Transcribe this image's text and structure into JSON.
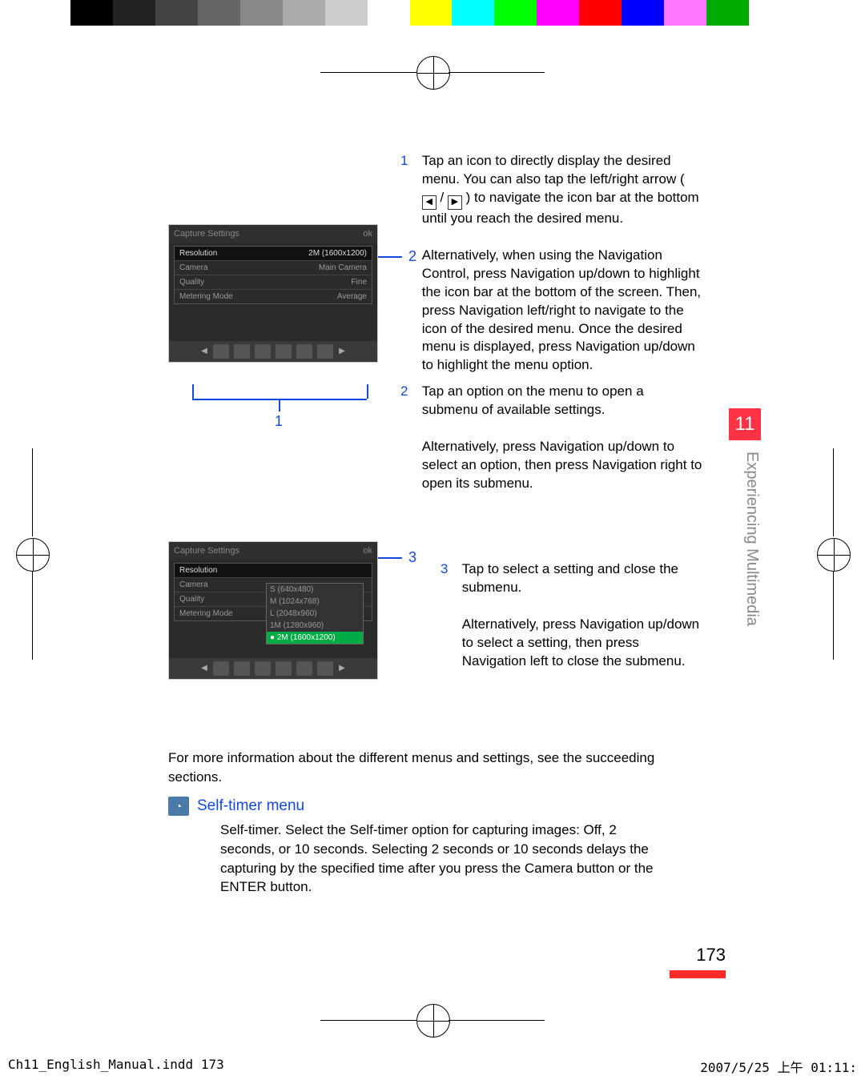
{
  "colorbar": [
    "#000",
    "#222",
    "#444",
    "#666",
    "#888",
    "#aaa",
    "#ccc",
    "#fff",
    "#ff0",
    "#0ff",
    "#0f0",
    "#f0f",
    "#f00",
    "#00f",
    "#f7f",
    "#0a0",
    "#fff"
  ],
  "chapter": {
    "number": "11",
    "title": "Experiencing Multimedia"
  },
  "page_number": "173",
  "callouts": {
    "c1": "1",
    "c2": "2",
    "c3": "3"
  },
  "screenshot1": {
    "title": "Capture Settings",
    "ok": "ok",
    "rows": [
      {
        "label": "Resolution",
        "value": "2M (1600x1200)",
        "sel": true
      },
      {
        "label": "Camera",
        "value": "Main Camera",
        "sel": false
      },
      {
        "label": "Quality",
        "value": "Fine",
        "sel": false
      },
      {
        "label": "Metering Mode",
        "value": "Average",
        "sel": false
      }
    ]
  },
  "screenshot2": {
    "title": "Capture Settings",
    "ok": "ok",
    "rows": [
      {
        "label": "Resolution",
        "value": "",
        "sel": true
      },
      {
        "label": "Camera",
        "value": "",
        "sel": false
      },
      {
        "label": "Quality",
        "value": "",
        "sel": false
      },
      {
        "label": "Metering Mode",
        "value": "",
        "sel": false
      }
    ],
    "dropdown": [
      {
        "t": "S (640x480)",
        "sel": false
      },
      {
        "t": "M (1024x768)",
        "sel": false
      },
      {
        "t": "L (2048x960)",
        "sel": false
      },
      {
        "t": "1M (1280x960)",
        "sel": false
      },
      {
        "t": "2M (1600x1200)",
        "sel": true
      }
    ]
  },
  "steps": {
    "s1a": "Tap an icon to directly display the desired menu. You can also tap the left/right arrow (",
    "s1b": ") to navigate the icon bar at the bottom until you reach the desired menu.",
    "s1c": "Alternatively, when using the Navigation Control, press Navigation up/down to highlight the icon bar at the bottom of the screen. Then, press Navigation left/right to navigate to the icon of the desired menu. Once the desired menu is displayed, press Navigation up/down to highlight the menu option.",
    "s2a": "Tap an option on the menu to open a submenu of available settings.",
    "s2b": "Alternatively, press Navigation up/down to select an option, then press Navigation right to open its submenu.",
    "s3a": "Tap to select a setting and close the submenu.",
    "s3b": "Alternatively, press Navigation up/down to select a setting, then press Navigation left to close the submenu."
  },
  "body": "For more information about the different menus and settings, see the succeeding sections.",
  "section": {
    "title": "Self-timer menu",
    "body": "Self-timer. Select the Self-timer option for capturing images: Off, 2 seconds, or 10 seconds. Selecting 2 seconds or 10 seconds delays the capturing by the speciﬁed time after you press the Camera button or the ENTER button."
  },
  "footer": {
    "left": "Ch11_English_Manual.indd   173",
    "right": "2007/5/25   上午 01:11:"
  }
}
